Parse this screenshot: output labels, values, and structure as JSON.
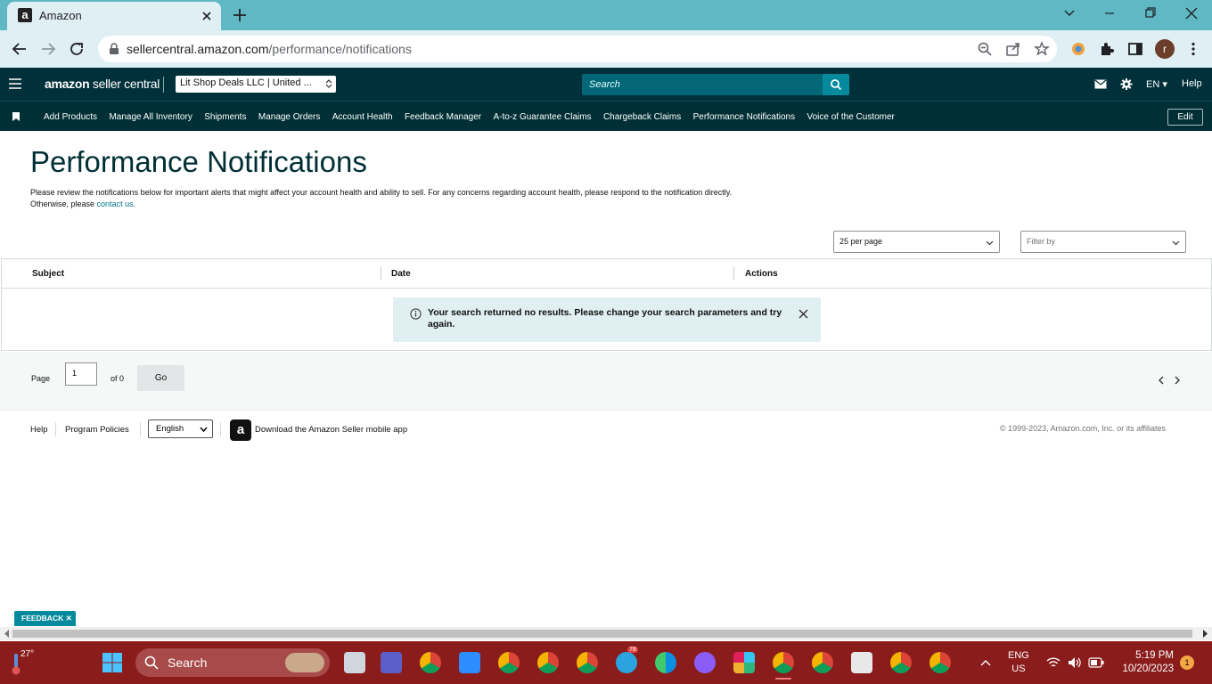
{
  "browser": {
    "tab_title": "Amazon",
    "tab_favicon": "a",
    "url_host": "sellercentral.amazon.com",
    "url_path": "/performance/notifications",
    "profile_initial": "r"
  },
  "header": {
    "brand_bold": "amazon",
    "brand_rest": " seller central",
    "account_selector": "Lit Shop Deals LLC | United ...",
    "search_placeholder": "Search",
    "language": "EN",
    "help": "Help"
  },
  "nav": {
    "items": [
      "Add Products",
      "Manage All Inventory",
      "Shipments",
      "Manage Orders",
      "Account Health",
      "Feedback Manager",
      "A-to-z Guarantee Claims",
      "Chargeback Claims",
      "Performance Notifications",
      "Voice of the Customer"
    ],
    "edit": "Edit"
  },
  "page": {
    "title": "Performance Notifications",
    "desc_line1": "Please review the notifications below for important alerts that might affect your account health and ability to sell. For any concerns regarding account health, please respond to the notification directly.",
    "desc_line2_prefix": "Otherwise, please ",
    "desc_link": "contact us",
    "desc_line2_suffix": ".",
    "per_page": "25 per page",
    "filter_placeholder": "Filter by"
  },
  "table": {
    "columns": [
      "Subject",
      "Date",
      "Actions"
    ],
    "empty_message": "Your search returned no results. Please change your search parameters and try again."
  },
  "pager": {
    "page_label": "Page",
    "page_value": "1",
    "of_label": "of 0",
    "go": "Go"
  },
  "footer": {
    "help": "Help",
    "policies": "Program Policies",
    "language": "English",
    "app_icon_letter": "a",
    "app_text": "Download the Amazon Seller mobile app",
    "copyright": "© 1999-2023, Amazon.com, Inc. or its affiliates"
  },
  "feedback": "FEEDBACK",
  "taskbar": {
    "temperature": "27°",
    "search": "Search",
    "input_lang": "ENG",
    "input_region": "US",
    "time": "5:19 PM",
    "date": "10/20/2023",
    "notification_count": "1",
    "telegram_badge": "78"
  },
  "colors": {
    "tabstrip": "#5fb8c4",
    "header": "#00303a",
    "accent": "#048a9c",
    "taskbar": "#8a1c1c"
  }
}
